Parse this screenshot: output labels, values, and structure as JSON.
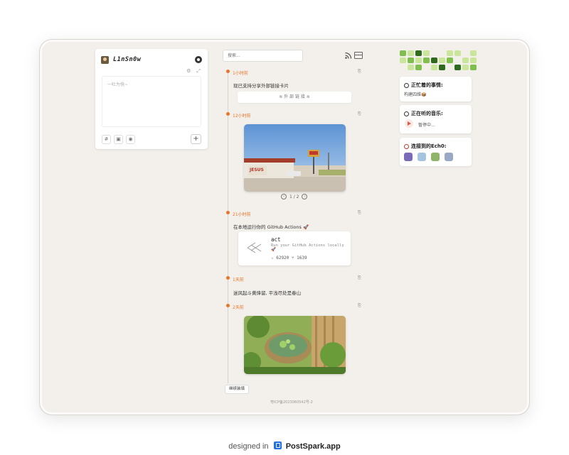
{
  "editor": {
    "username": "L1nSn0w",
    "placeholder": "一吐为快~",
    "add_label": "+"
  },
  "search": {
    "placeholder": "搜索..."
  },
  "timeline": [
    {
      "time": "1小时前",
      "text": "现已支持分享外部链接卡片",
      "ext_label": "≋ 外 部 链 接 ≋"
    },
    {
      "time": "12小时前",
      "pager": "1 / 2"
    },
    {
      "time": "21小时前",
      "text": "在本地运行你的 GitHub Actions 🚀",
      "repo": {
        "name": "act",
        "desc": "Run your GitHub Actions locally 🚀",
        "stars": "☆ 62920",
        "forks": "⑂ 1639"
      }
    },
    {
      "time": "1天前",
      "text": "迷风起斗黄烽留, 平浅尽处是春山"
    },
    {
      "time": "2天前"
    }
  ],
  "load_more": "继续装填",
  "footer": "粤ICP备2023060542号-2",
  "widgets": {
    "busy": {
      "title": "正忙着的事情:",
      "value": "构建四维📦"
    },
    "music": {
      "title": "正在听的音乐:",
      "value": "暂停中..."
    },
    "connect": {
      "title": "连接到的Ech0:"
    }
  },
  "credit": {
    "prefix": "designed in",
    "brand": "PostSpark.app"
  },
  "colors": {
    "accent": "#e8742a",
    "heat_dark": "#2e6b1f",
    "heat_mid": "#7fbf4d",
    "heat_light": "#c9e69a"
  }
}
